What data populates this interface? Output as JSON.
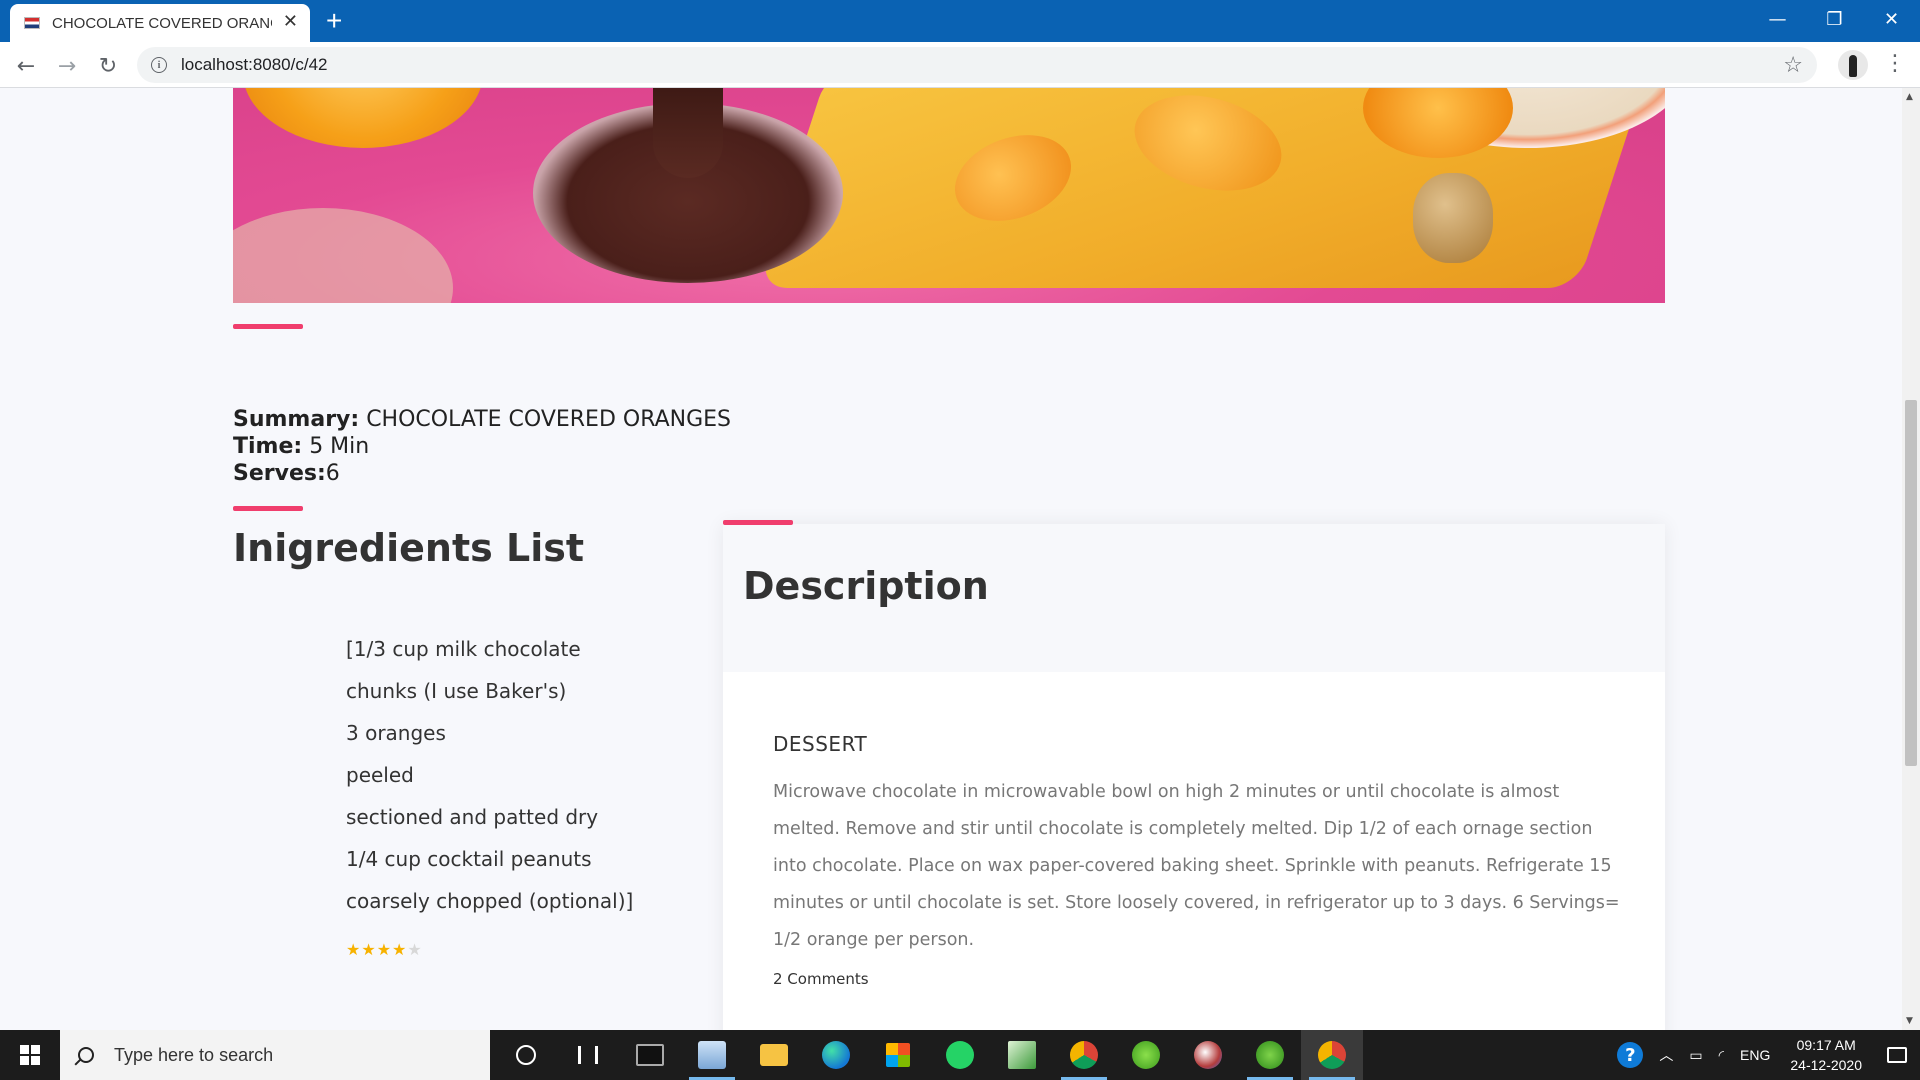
{
  "browser": {
    "tab_title": "CHOCOLATE COVERED ORANGE",
    "tab_close": "✕",
    "new_tab": "+",
    "url": "localhost:8080/c/42",
    "window": {
      "minimize": "—",
      "restore": "❐",
      "close": "✕"
    },
    "nav": {
      "back": "←",
      "forward": "→",
      "reload": "↻"
    }
  },
  "recipe": {
    "summary_label": "Summary:",
    "summary_value": " CHOCOLATE COVERED ORANGES",
    "time_label": "Time:",
    "time_value": " 5 Min",
    "serves_label": "Serves:",
    "serves_value": "6",
    "ingredients_title": "Inigredients List",
    "ingredients": [
      "[1/3 cup milk chocolate",
      "chunks (I use Baker's)",
      "3 oranges",
      "peeled",
      "sectioned and patted dry",
      "1/4 cup cocktail peanuts",
      "coarsely chopped (optional)]"
    ],
    "rating": {
      "value": 4,
      "max": 5
    },
    "description_title": "Description",
    "category": "DESSERT",
    "description": "Microwave chocolate in microwavable bowl on high 2 minutes or until chocolate is almost melted. Remove and stir until chocolate is completely melted. Dip 1/2 of each ornage section into chocolate. Place on wax paper-covered baking sheet. Sprinkle with peanuts. Refrigerate 15 minutes or until chocolate is set. Store loosely covered, in refrigerator up to 3 days. 6 Servings= 1/2 orange per person.",
    "comments": "2 Comments"
  },
  "colors": {
    "accent": "#f03e6d",
    "titlebar": "#0a62b3"
  },
  "taskbar": {
    "search_placeholder": "Type here to search",
    "icons": [
      "cortana-icon",
      "task-view-icon",
      "terminal-icon",
      "photos-icon",
      "file-explorer-icon",
      "edge-icon",
      "store-icon",
      "whatsapp-icon",
      "spreadsheet-icon",
      "chrome-icon",
      "spring-tool-icon",
      "paint-icon",
      "spring-boot-icon",
      "chrome-profile-icon"
    ],
    "language": "ENG",
    "time": "09:17 AM",
    "date": "24-12-2020"
  }
}
